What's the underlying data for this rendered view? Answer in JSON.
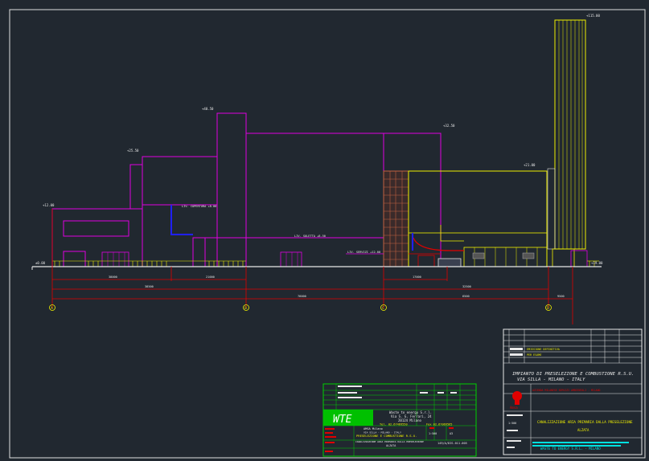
{
  "drawing": {
    "elevations": {
      "chimney_top": "+115.00",
      "tower_top": "+40.50",
      "hall_top": "+32.50",
      "block_top": "+25.50",
      "low_top": "+12.00",
      "right_top": "+21.00",
      "roof_label": "+19.00",
      "zero": "±0.00"
    },
    "floor_labels": {
      "upper": "LIV. COPERTURA +8.00",
      "mid": "LIV. SERVIZI +12.00",
      "low": "LIV. PIANO TERRA +0.00",
      "main": "LIV. SOLETTA +8.50"
    },
    "dims": {
      "d1": "38000",
      "d2": "21000",
      "d3": "38500",
      "d4": "17000",
      "d5": "76000",
      "d6": "32500",
      "d7": "9500",
      "d8": "6500"
    },
    "axes": [
      "A",
      "B",
      "C",
      "D"
    ]
  },
  "title_block_left": {
    "logo": "WTE",
    "company_line1": "Waste to energy S.r.l.",
    "company_line2": "Via S. G. Ferrari, 24",
    "company_line3": "20124 Milano",
    "phone": "Tel. 02.67469550",
    "fax": "Fax 02.67069565",
    "client": "AMSA Milano",
    "address": "VIA SILLA - MILANO - ITALY",
    "project": "PRESELEZIONE E COMBUSTIONE R.S.U.",
    "subject": "CANALIZZAZIONE ARIA PRIMARIA DALLA PRESELEZIONE",
    "view": "ALZATA",
    "scale": "1:500",
    "sheet": "A3",
    "drawing_no": "149/A/DIS.011.005"
  },
  "title_block_right": {
    "rev_row1": "EMISSIONE DEFINITIVA",
    "rev_row2": "PER ESAME",
    "title_line1": "IMPIANTO DI PRESELEZIONE E COMBUSTIONE R.S.U.",
    "title_line2": "VIA SILLA - MILANO - ITALY",
    "client_name": "Amsa",
    "sub_line": "AZIENDA MILANESE SERVIZI AMBIENTALI - MILANO",
    "subject": "CANALIZZAZIONE ARIA PRIMARIA DALLA PRESELEZIONE",
    "view": "ALZATA",
    "scale": "1:500",
    "footer": "WASTE TO ENERGY S.R.L. - MILANO"
  },
  "colors": {
    "background": "#212830",
    "magenta": "#e000e0",
    "yellow": "#f0f000",
    "red": "#e00000",
    "green": "#00d000",
    "white": "#e8e8e8",
    "cyan": "#00e0e0",
    "blue": "#2020ff",
    "brown": "#c06040"
  }
}
